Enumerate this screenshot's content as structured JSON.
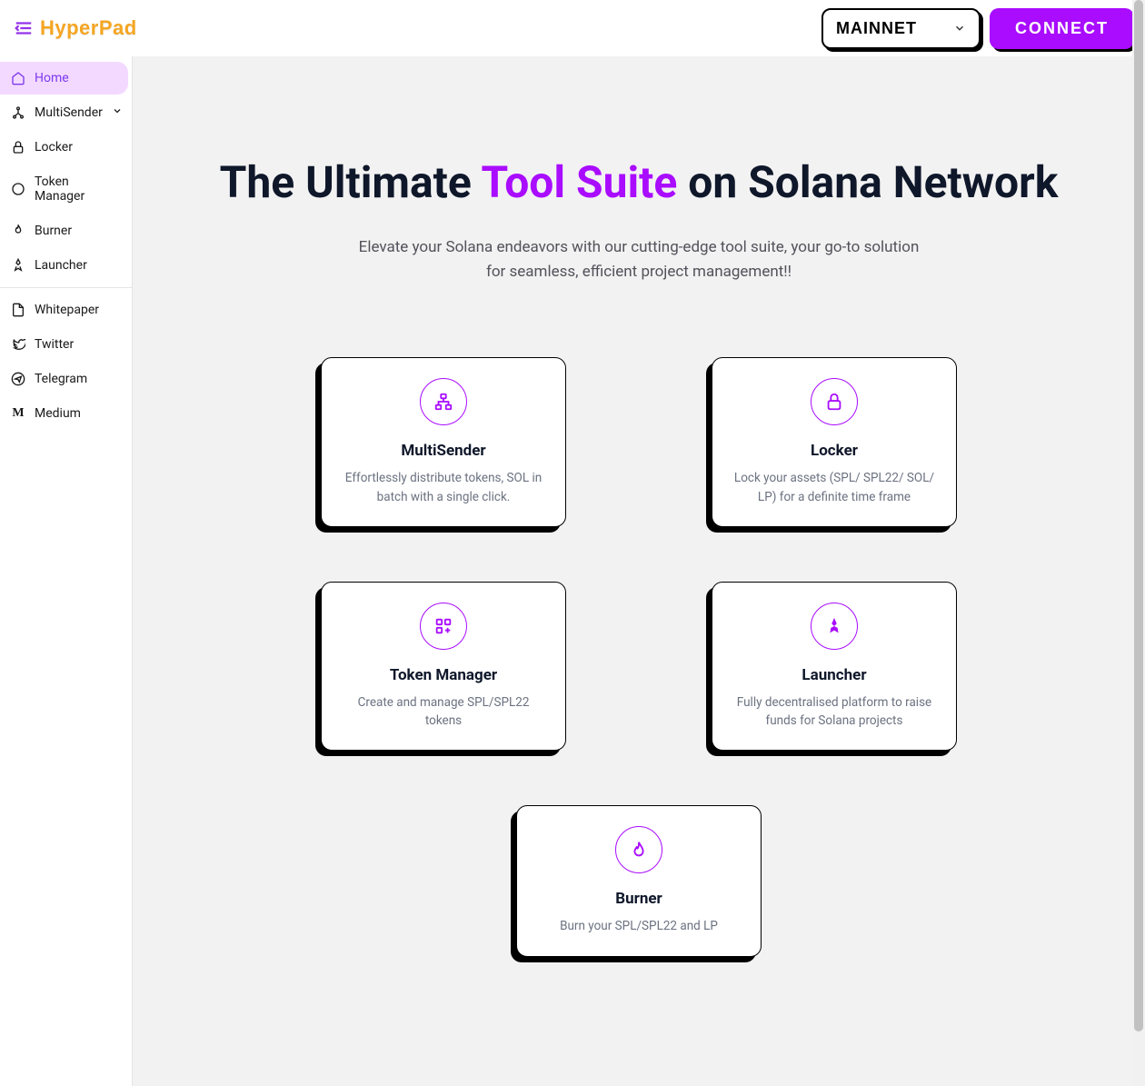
{
  "header": {
    "logo": "HyperPad",
    "network": "MAINNET",
    "connect_label": "CONNECT"
  },
  "sidebar": {
    "groups": [
      [
        {
          "label": "Home",
          "icon": "home-icon",
          "active": true
        },
        {
          "label": "MultiSender",
          "icon": "multisender-icon",
          "expandable": true
        },
        {
          "label": "Locker",
          "icon": "lock-icon"
        },
        {
          "label": "Token Manager",
          "icon": "token-icon"
        },
        {
          "label": "Burner",
          "icon": "fire-icon"
        },
        {
          "label": "Launcher",
          "icon": "rocket-icon"
        }
      ],
      [
        {
          "label": "Whitepaper",
          "icon": "document-icon"
        },
        {
          "label": "Twitter",
          "icon": "twitter-icon"
        },
        {
          "label": "Telegram",
          "icon": "telegram-icon"
        },
        {
          "label": "Medium",
          "icon": "medium-icon"
        }
      ]
    ]
  },
  "hero": {
    "title_pre": "The Ultimate ",
    "title_accent": "Tool Suite",
    "title_post": " on Solana Network",
    "sub": "Elevate your Solana endeavors with our cutting-edge tool suite, your go-to solution for seamless, efficient project management!!"
  },
  "cards": [
    {
      "title": "MultiSender",
      "desc": "Effortlessly distribute tokens, SOL in batch with a single click.",
      "icon": "network-icon"
    },
    {
      "title": "Locker",
      "desc": "Lock your assets (SPL/ SPL22/ SOL/ LP) for a definite time frame",
      "icon": "lock-icon"
    },
    {
      "title": "Token Manager",
      "desc": "Create and manage SPL/SPL22 tokens",
      "icon": "grid-plus-icon"
    },
    {
      "title": "Launcher",
      "desc": "Fully decentralised platform to raise funds for Solana projects",
      "icon": "rocket-fill-icon"
    },
    {
      "title": "Burner",
      "desc": "Burn your SPL/SPL22 and LP",
      "icon": "fire-icon"
    }
  ]
}
